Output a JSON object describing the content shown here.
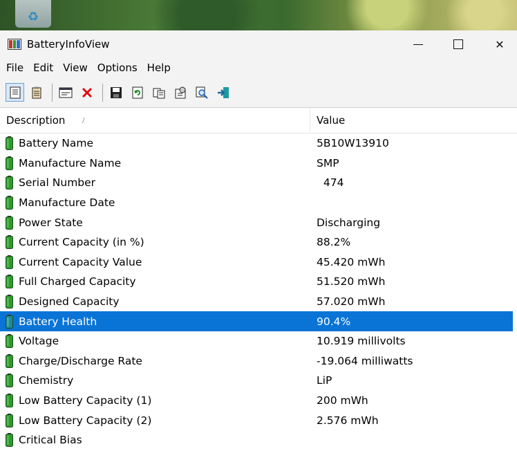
{
  "window": {
    "title": "BatteryInfoView"
  },
  "menu": [
    "File",
    "Edit",
    "View",
    "Options",
    "Help"
  ],
  "toolbar": [
    {
      "name": "html-report-icon"
    },
    {
      "name": "copy-selected-icon"
    },
    {
      "name": "properties-window-icon"
    },
    {
      "name": "delete-icon"
    },
    {
      "name": "save-icon"
    },
    {
      "name": "refresh-icon"
    },
    {
      "name": "copy-icon"
    },
    {
      "name": "advanced-options-icon"
    },
    {
      "name": "find-icon"
    },
    {
      "name": "exit-icon"
    }
  ],
  "columns": {
    "description": "Description",
    "value": "Value"
  },
  "rows": [
    {
      "description": "Battery Name",
      "value": "5B10W13910"
    },
    {
      "description": "Manufacture Name",
      "value": "SMP"
    },
    {
      "description": "Serial Number",
      "value": "  474"
    },
    {
      "description": "Manufacture Date",
      "value": ""
    },
    {
      "description": "Power State",
      "value": "Discharging"
    },
    {
      "description": "Current Capacity (in %)",
      "value": "88.2%"
    },
    {
      "description": "Current Capacity Value",
      "value": "45.420 mWh"
    },
    {
      "description": "Full Charged Capacity",
      "value": "51.520 mWh"
    },
    {
      "description": "Designed Capacity",
      "value": "57.020 mWh"
    },
    {
      "description": "Battery Health",
      "value": "90.4%",
      "selected": true
    },
    {
      "description": "Voltage",
      "value": "10.919 millivolts"
    },
    {
      "description": "Charge/Discharge Rate",
      "value": "-19.064 milliwatts"
    },
    {
      "description": "Chemistry",
      "value": "LiP"
    },
    {
      "description": "Low Battery Capacity (1)",
      "value": "200 mWh"
    },
    {
      "description": "Low Battery Capacity (2)",
      "value": "2.576 mWh"
    },
    {
      "description": "Critical Bias",
      "value": ""
    }
  ],
  "colors": {
    "selection": "#0a74d6",
    "battery": "#2e9a2e"
  }
}
